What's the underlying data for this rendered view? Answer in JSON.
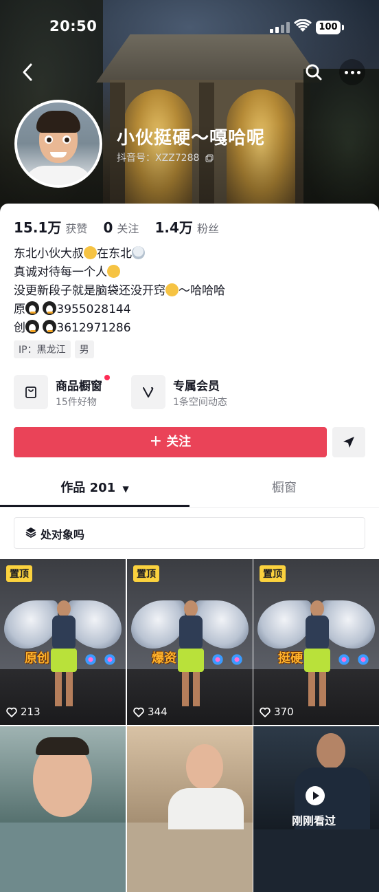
{
  "status_bar": {
    "time": "20:50",
    "battery": "100"
  },
  "profile": {
    "name": "小伙挺硬～嘎哈呢",
    "uid_label": "抖音号：XZZ7288"
  },
  "stats": [
    {
      "value": "15.1万",
      "label": "获赞"
    },
    {
      "value": "0",
      "label": "关注"
    },
    {
      "value": "1.4万",
      "label": "粉丝"
    }
  ],
  "bio": {
    "line1a": "东北小伙大叔",
    "line1b": "在东北",
    "line2": "真诚对待每一个人",
    "line3a": "没更新段子就是脑袋还没开窍",
    "line3b": "～哈哈哈",
    "line4a": "原",
    "line4b": "3955028144",
    "line5a": "创",
    "line5b": "3612971286"
  },
  "tags": [
    "IP：黑龙江",
    "男"
  ],
  "shops": [
    {
      "title": "商品橱窗",
      "subtitle": "15件好物",
      "icon": "bag-icon"
    },
    {
      "title": "专属会员",
      "subtitle": "1条空间动态",
      "icon": "vip-v-icon"
    }
  ],
  "follow_label": "＋ 关注",
  "tabs": {
    "works": "作品 201",
    "showcase": "橱窗"
  },
  "collection_label": "处对象吗",
  "grid": [
    {
      "pin": "置顶",
      "caption": "原创",
      "likes": "213"
    },
    {
      "pin": "置顶",
      "caption": "爆资",
      "likes": "344"
    },
    {
      "pin": "置顶",
      "caption": "挺硬",
      "likes": "370"
    }
  ],
  "recently_watched": "刚刚看过",
  "colors": {
    "follow": "#ea4358",
    "pin": "#fbd23e",
    "dot": "#fe2c55"
  }
}
